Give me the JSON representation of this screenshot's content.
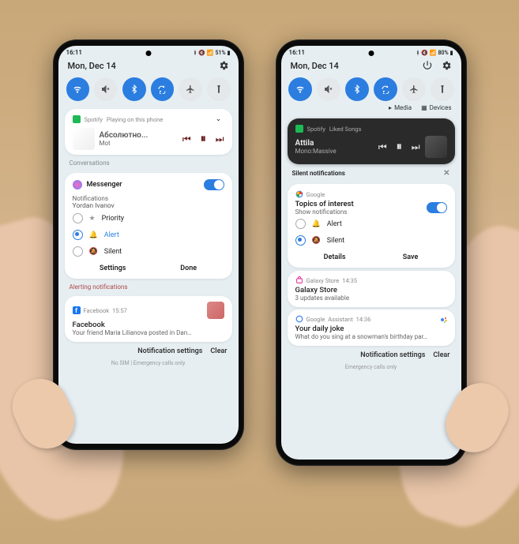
{
  "left": {
    "time": "16:11",
    "battery": "51%",
    "date": "Mon, Dec 14",
    "spotify_tag": "Spotify",
    "spotify_status": "Playing on this phone",
    "track_title": "Абсолютно...",
    "track_artist": "Mot",
    "conversations_label": "Conversations",
    "messenger_name": "Messenger",
    "notif_label": "Notifications",
    "contact_name": "Yordan Ivanov",
    "priority_label": "Priority",
    "alert_label": "Alert",
    "silent_label": "Silent",
    "settings_btn": "Settings",
    "done_btn": "Done",
    "alerting_label": "Alerting notifications",
    "fb_tag": "Facebook",
    "fb_time": "15:57",
    "fb_title": "Facebook",
    "fb_body": "Your friend Maria Lilianova posted in Dan…",
    "footer_settings": "Notification settings",
    "footer_clear": "Clear",
    "sim_line": "No SIM | Emergency calls only"
  },
  "right": {
    "time": "16:11",
    "battery": "80%",
    "date": "Mon, Dec 14",
    "media_chip": "Media",
    "devices_chip": "Devices",
    "spotify_tag": "Spotify",
    "spotify_status": "Liked Songs",
    "track_title": "Attila",
    "track_artist": "Mono:Massive",
    "silent_header": "Silent notifications",
    "google_tag": "Google",
    "topic_title": "Topics of interest",
    "topic_sub": "Show notifications",
    "alert_label": "Alert",
    "silent_label": "Silent",
    "details_btn": "Details",
    "save_btn": "Save",
    "gs_tag": "Galaxy Store",
    "gs_time": "14:35",
    "gs_title": "Galaxy Store",
    "gs_body": "3 updates available",
    "ga_tag": "Google",
    "ga_sub": "Assistant",
    "ga_time": "14:36",
    "ga_title": "Your daily joke",
    "ga_body": "What do you sing at a snowman's birthday par…",
    "footer_settings": "Notification settings",
    "footer_clear": "Clear",
    "sim_line": "Emergency calls only"
  }
}
